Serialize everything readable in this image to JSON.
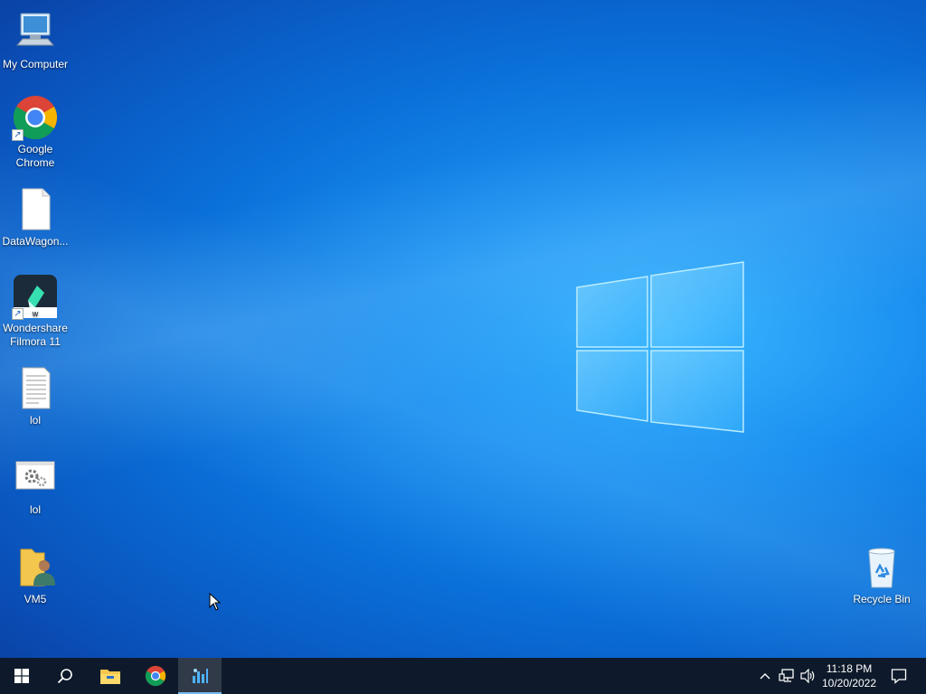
{
  "desktop": {
    "icons": [
      {
        "label": "My Computer",
        "icon": "computer-icon"
      },
      {
        "label": "Google Chrome",
        "icon": "chrome-icon",
        "shortcut": true
      },
      {
        "label": "DataWagon...",
        "icon": "blank-file-icon"
      },
      {
        "label": "Wondershare Filmora 11",
        "icon": "filmora-icon",
        "shortcut": true
      },
      {
        "label": "lol",
        "icon": "text-file-icon"
      },
      {
        "label": "lol",
        "icon": "settings-file-icon"
      },
      {
        "label": "VM5",
        "icon": "user-folder-icon"
      }
    ],
    "recycle_bin": {
      "label": "Recycle Bin",
      "icon": "recycle-bin-icon"
    }
  },
  "taskbar": {
    "buttons": [
      {
        "name": "start",
        "icon": "windows-start-icon"
      },
      {
        "name": "search",
        "icon": "search-icon"
      },
      {
        "name": "file-explorer",
        "icon": "folder-icon"
      },
      {
        "name": "chrome",
        "icon": "chrome-icon"
      },
      {
        "name": "active-app",
        "icon": "app-icon",
        "active": true
      }
    ],
    "tray": {
      "icons": [
        "chevron-up-icon",
        "network-icon",
        "volume-icon"
      ],
      "time": "11:18 PM",
      "date": "10/20/2022"
    }
  },
  "colors": {
    "taskbar": "#0e1a2b",
    "accent": "#76b9ed",
    "desktop_blue": "#0a6fd8"
  }
}
